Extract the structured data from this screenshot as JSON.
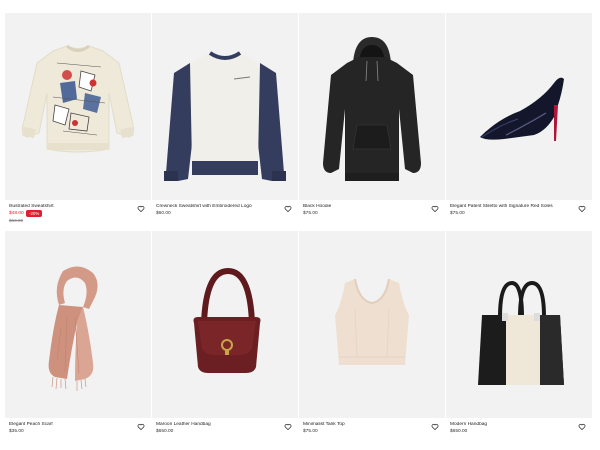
{
  "products": [
    {
      "title": "Illustrated Sweatshirt",
      "price": "$48.00",
      "badge": "-20%",
      "old_price": "$60.00",
      "icon": "heart-icon"
    },
    {
      "title": "Crewneck Sweatshirt with Embroidered Logo",
      "price": "$60.00",
      "icon": "heart-icon"
    },
    {
      "title": "Black Hoodie",
      "price": "$75.00",
      "icon": "heart-icon"
    },
    {
      "title": "Elegant Patent Stiletto with Signature Red Soles",
      "price": "$75.00",
      "icon": "heart-icon"
    },
    {
      "title": "Elegant Peach Scarf",
      "price": "$35.00",
      "icon": "heart-icon"
    },
    {
      "title": "Maroon Leather Handbag",
      "price": "$650.00",
      "icon": "heart-icon"
    },
    {
      "title": "Minimalist Tank Top",
      "price": "$75.00",
      "icon": "heart-icon"
    },
    {
      "title": "Modern Handbag",
      "price": "$650.00",
      "icon": "heart-icon"
    }
  ],
  "colors": {
    "sale": "#e01e2d",
    "image_bg": "#f2f2f2"
  }
}
